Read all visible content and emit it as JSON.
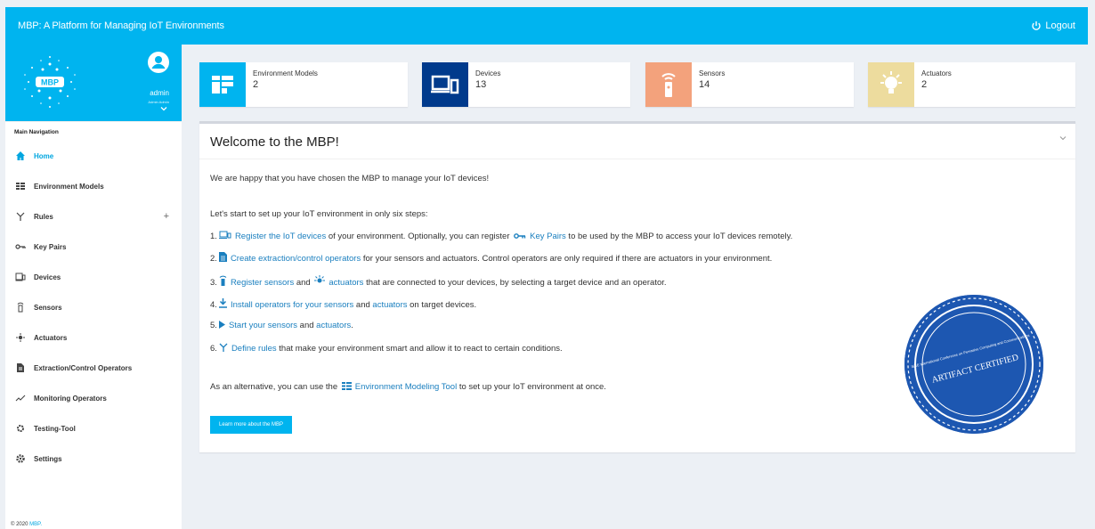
{
  "app": {
    "title": "MBP: A Platform for Managing IoT Environments",
    "logout_label": "Logout",
    "logo_text": "MBP"
  },
  "user": {
    "name": "admin",
    "role": "Admin Admin"
  },
  "sidebar": {
    "header": "Main Navigation",
    "items": [
      {
        "label": "Home",
        "icon": "home-icon"
      },
      {
        "label": "Environment Models",
        "icon": "grid-icon"
      },
      {
        "label": "Rules",
        "icon": "rules-icon"
      },
      {
        "label": "Key Pairs",
        "icon": "key-icon"
      },
      {
        "label": "Devices",
        "icon": "devices-icon"
      },
      {
        "label": "Sensors",
        "icon": "sensor-icon"
      },
      {
        "label": "Actuators",
        "icon": "actuator-icon"
      },
      {
        "label": "Extraction/Control Operators",
        "icon": "file-icon"
      },
      {
        "label": "Monitoring Operators",
        "icon": "chart-line-icon"
      },
      {
        "label": "Testing-Tool",
        "icon": "cogs-icon"
      },
      {
        "label": "Settings",
        "icon": "gear-icon"
      }
    ],
    "rules_expand": "+",
    "footer_prefix": "© 2020",
    "footer_link": "MBP."
  },
  "stats": [
    {
      "label": "Environment Models",
      "value": "2",
      "color": "#00b4ef"
    },
    {
      "label": "Devices",
      "value": "13",
      "color": "#003a8c"
    },
    {
      "label": "Sensors",
      "value": "14",
      "color": "#f3a27c"
    },
    {
      "label": "Actuators",
      "value": "2",
      "color": "#eddc9e"
    }
  ],
  "welcome": {
    "title": "Welcome to the MBP!",
    "intro": "We are happy that you have chosen the MBP to manage your IoT devices!",
    "start": "Let's start to set up your IoT environment in only six steps:",
    "step1": {
      "n": "1.",
      "link": "Register the IoT devices",
      "t1": " of your environment. Optionally, you can register ",
      "link2": "Key Pairs",
      "t2": " to be used by the MBP to access your IoT devices remotely."
    },
    "step2": {
      "n": "2.",
      "link": "Create extraction/control operators",
      "t1": " for your sensors and actuators. Control operators are only required if there are actuators in your environment."
    },
    "step3": {
      "n": "3.",
      "link": "Register sensors",
      "t1": " and ",
      "link2": "actuators",
      "t2": " that are connected to your devices, by selecting a target device and an operator."
    },
    "step4": {
      "n": "4.",
      "link": "Install operators for your sensors",
      "t1": " and ",
      "link2": "actuators",
      "t2": " on target devices."
    },
    "step5": {
      "n": "5.",
      "link": "Start your sensors",
      "t1": " and ",
      "link2": "actuators",
      "t2": "."
    },
    "step6": {
      "n": "6.",
      "link": "Define rules",
      "t1": " that make your environment smart and allow it to react to certain conditions."
    },
    "alt_prefix": "As an alternative, you can use the ",
    "alt_link": "Environment Modeling Tool",
    "alt_suffix": " to set up your IoT environment at once.",
    "button": "Learn more about the MBP",
    "seal_top": "IEEE International Conference on Pervasive Computing and Communications",
    "seal_main": "ARTIFACT CERTIFIED"
  }
}
